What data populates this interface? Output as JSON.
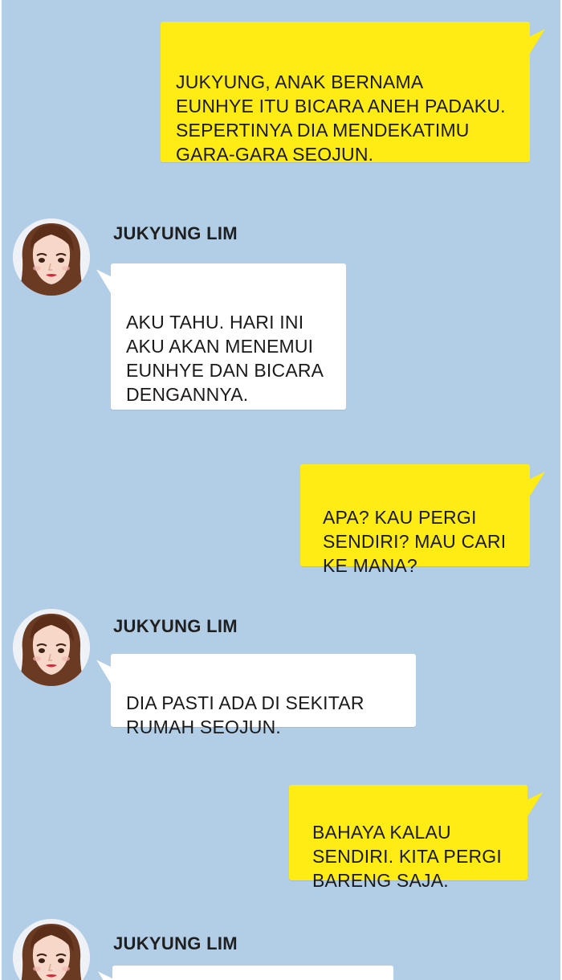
{
  "contact": {
    "name": "JUKYUNG LIM"
  },
  "messages": [
    {
      "type": "out",
      "text": "JUKYUNG, ANAK BERNAMA\nEUNHYE ITU BICARA ANEH PADAKU.\nSEPERTINYA DIA MENDEKATIMU\nGARA-GARA SEOJUN."
    },
    {
      "type": "in",
      "sender": "JUKYUNG LIM",
      "text": "AKU TAHU. HARI INI\nAKU AKAN MENEMUI\nEUNHYE DAN BICARA\nDENGANNYA."
    },
    {
      "type": "out",
      "text": "APA? KAU PERGI\nSENDIRI? MAU CARI\nKE MANA?"
    },
    {
      "type": "in",
      "sender": "JUKYUNG LIM",
      "text": "DIA PASTI ADA DI SEKITAR\nRUMAH SEOJUN."
    },
    {
      "type": "out",
      "text": "BAHAYA KALAU\nSENDIRI. KITA PERGI\nBARENG SAJA."
    },
    {
      "type": "in",
      "sender": "JUKYUNG LIM",
      "text": ""
    }
  ],
  "colors": {
    "background": "#b2cde6",
    "outgoing_bubble": "#ffec14",
    "incoming_bubble": "#ffffff"
  },
  "icons": {
    "avatar": "profile-photo-woman"
  }
}
